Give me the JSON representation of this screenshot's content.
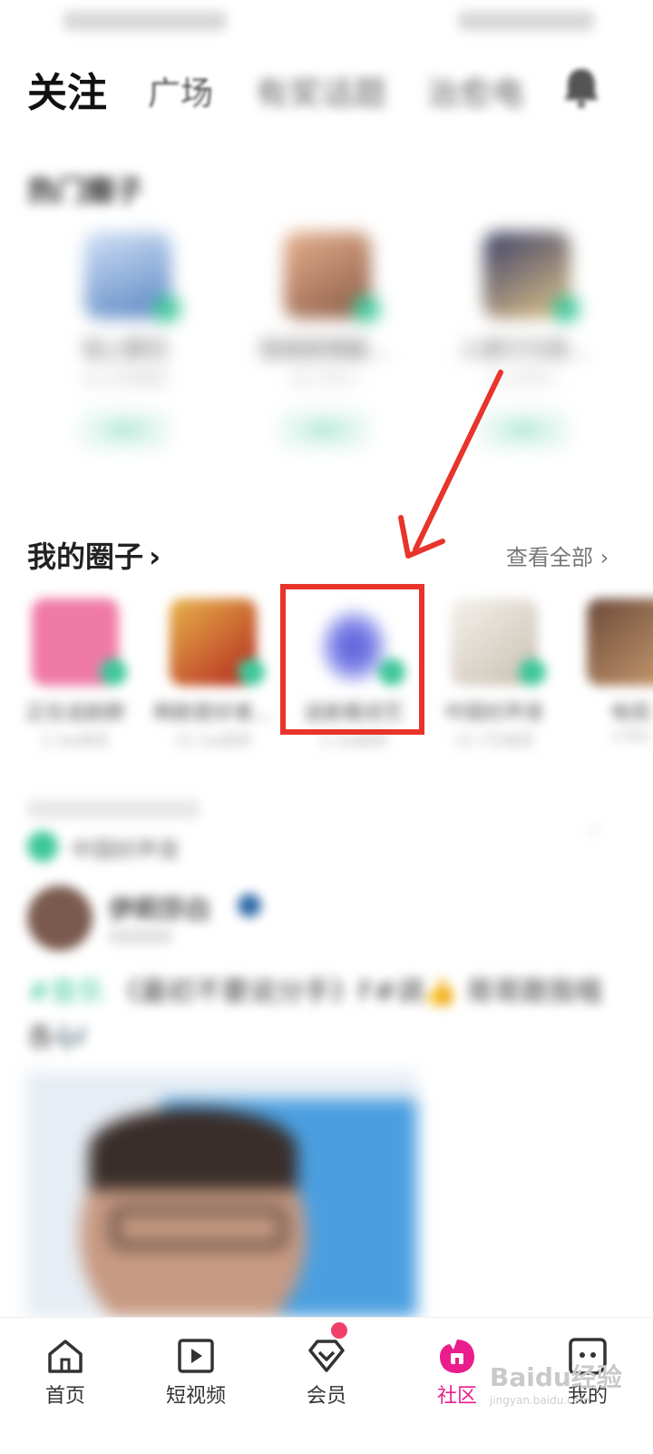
{
  "top_tabs": [
    {
      "label": "关注"
    },
    {
      "label": "广场"
    },
    {
      "label": "有奖话题"
    },
    {
      "label": "治愈电"
    }
  ],
  "hot_section": {
    "title": "热门圈子",
    "cards": [
      {
        "name": "海上繁花",
        "sub": "11.2万成员",
        "join_label": "+加入"
      },
      {
        "name": "我爱剧情截...",
        "sub": "12.7万人",
        "join_label": "+加入"
      },
      {
        "name": "人类行为观...",
        "sub": "11.3万人",
        "join_label": "+加入"
      }
    ]
  },
  "my_section": {
    "title": "我的圈子",
    "chevron": "›",
    "view_all": "查看全部 ›",
    "items": [
      {
        "name": "正在追剧群",
        "sub": "2.3w成员"
      },
      {
        "name": "韩剧爱好者...",
        "sub": "12.1w成员"
      },
      {
        "name": "追剧看综艺",
        "sub": "1.2w成员"
      },
      {
        "name": "中国好声音",
        "sub": "12.7万成员"
      },
      {
        "name": "电视",
        "sub": "2.6w"
      }
    ]
  },
  "feed": {
    "circle_name": "中国好声音",
    "more": "›",
    "username": "伊莉莎白",
    "post_tag": "#音乐",
    "post_text": " 《最初不要说分手》F#调👍 哥哥跟我唱各🎶"
  },
  "bottom_nav": [
    {
      "label": "首页",
      "icon": "home-icon"
    },
    {
      "label": "短视频",
      "icon": "video-icon"
    },
    {
      "label": "会员",
      "icon": "diamond-icon"
    },
    {
      "label": "社区",
      "icon": "community-icon"
    },
    {
      "label": "我的",
      "icon": "profile-icon"
    }
  ],
  "watermark": {
    "text": "Baidu经验",
    "sub": "jingyan.baidu.com"
  },
  "colors": {
    "accent_green": "#3ec79a",
    "active_pink": "#e91e8c",
    "highlight_red": "#e8342a"
  }
}
